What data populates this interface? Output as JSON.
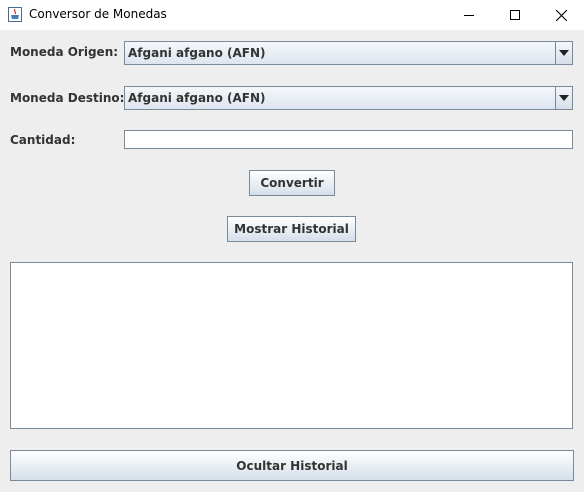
{
  "window": {
    "title": "Conversor de Monedas",
    "icon": "java-coffee-icon"
  },
  "form": {
    "origin_label": "Moneda Origen:",
    "origin_value": "Afgani afgano (AFN)",
    "dest_label": "Moneda Destino:",
    "dest_value": "Afgani afgano (AFN)",
    "amount_label": "Cantidad:",
    "amount_value": ""
  },
  "buttons": {
    "convert": "Convertir",
    "show_history": "Mostrar Historial",
    "hide_history": "Ocultar Historial"
  },
  "history": {
    "text": ""
  },
  "colors": {
    "background": "#eeeeee",
    "border": "#7a8a99",
    "text": "#333333"
  }
}
